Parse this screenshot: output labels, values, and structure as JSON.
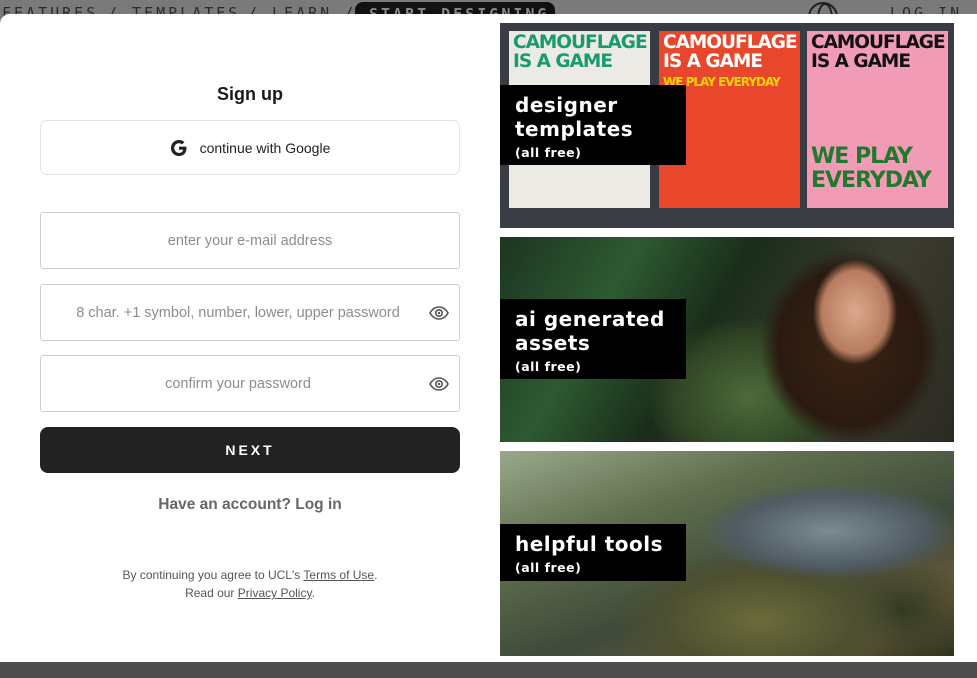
{
  "background_nav": {
    "items": [
      "FEATURES",
      "/ TEMPLATES",
      "/ LEARN /"
    ],
    "pill": "START DESIGNING",
    "right": "LOG IN",
    "globe_icon": "globe-icon"
  },
  "signup": {
    "title": "Sign up",
    "google_label": "continue with Google",
    "email_placeholder": "enter your e-mail address",
    "password_placeholder": "8 char. +1 symbol, number, lower, upper password",
    "confirm_placeholder": "confirm your password",
    "next_label": "NEXT",
    "have_account": "Have an account?",
    "login_link": "Log in",
    "legal_prefix": "By continuing you agree to UCL's",
    "terms_link": "Terms of Use",
    "legal_read": "Read our",
    "privacy_link": "Privacy Policy"
  },
  "panels": [
    {
      "title": "designer templates",
      "subtitle": "(all free)"
    },
    {
      "title": "ai generated assets",
      "subtitle": "(all free)"
    },
    {
      "title": "helpful tools",
      "subtitle": "(all free)"
    }
  ],
  "posters": [
    {
      "headline": "CAMOUFLAGE IS A GAME"
    },
    {
      "headline": "CAMOUFLAGE IS A GAME",
      "tagline": "WE PLAY EVERYDAY"
    },
    {
      "headline": "CAMOUFLAGE IS A GAME",
      "tagline": "WE PLAY EVERYDAY"
    }
  ],
  "colors": {
    "button_dark": "#222222",
    "poster_green": "#1a9a70",
    "poster_red": "#e9472c",
    "poster_pink": "#f29bb6"
  }
}
